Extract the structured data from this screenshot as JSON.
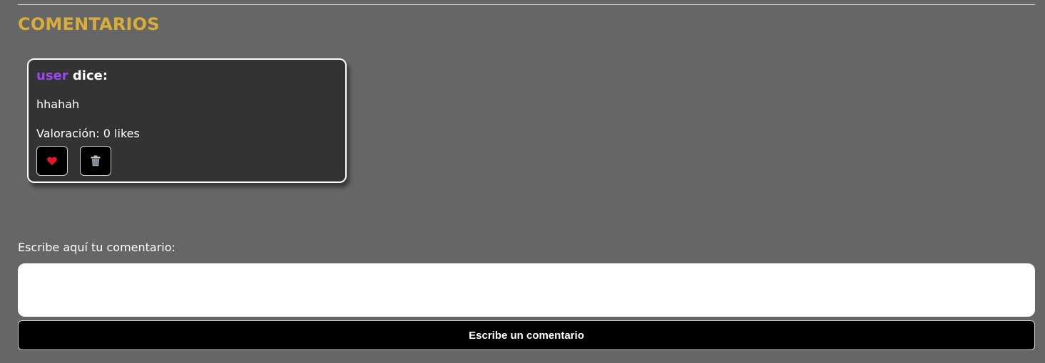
{
  "section": {
    "title": "COMENTARIOS"
  },
  "comment": {
    "author": "user",
    "author_suffix": " dice:",
    "text": "hhahah",
    "rating_label": "Valoración: ",
    "likes": "0",
    "likes_unit": " likes",
    "like_icon": "heart-icon",
    "delete_icon": "trash-icon"
  },
  "form": {
    "label": "Escribe aquí tu comentario:",
    "placeholder": "",
    "value": "",
    "submit_label": "Escribe un comentario"
  },
  "colors": {
    "background": "#666666",
    "title": "#d9ad3a",
    "author": "#9b47f0",
    "card": "#333333",
    "heart": "#e8142c",
    "button": "#000000"
  }
}
